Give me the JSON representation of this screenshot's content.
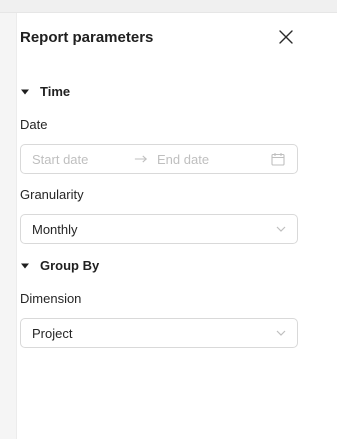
{
  "panel": {
    "title": "Report parameters"
  },
  "sections": {
    "time": {
      "label": "Time",
      "date": {
        "label": "Date",
        "start_placeholder": "Start date",
        "end_placeholder": "End date"
      },
      "granularity": {
        "label": "Granularity",
        "value": "Monthly"
      }
    },
    "group_by": {
      "label": "Group By",
      "dimension": {
        "label": "Dimension",
        "value": "Project"
      }
    }
  },
  "icons": {
    "close": "close-icon",
    "collapse": "caret-down-icon",
    "arrow": "arrow-right-icon",
    "calendar": "calendar-icon",
    "dropdown": "chevron-down-icon"
  }
}
